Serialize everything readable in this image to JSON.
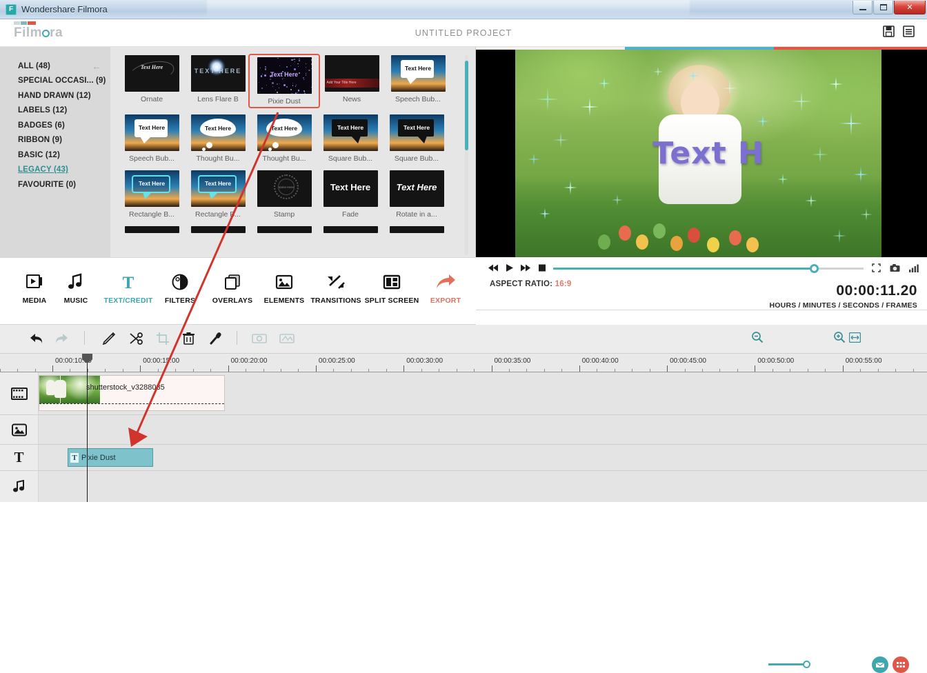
{
  "window": {
    "title": "Wondershare Filmora",
    "app_icon": "F",
    "minimize": "minimize-icon",
    "maximize": "maximize-icon",
    "close": "✕"
  },
  "header": {
    "brand": "Film",
    "brand_suffix": "ra",
    "project_title": "UNTITLED PROJECT",
    "save_icon": "save-icon",
    "menu_icon": "menu-icon"
  },
  "library": {
    "categories": [
      {
        "label": "ALL (48)",
        "active": false
      },
      {
        "label": "SPECIAL OCCASI...  (9)",
        "active": false
      },
      {
        "label": "HAND DRAWN (12)",
        "active": false
      },
      {
        "label": "LABELS (12)",
        "active": false
      },
      {
        "label": "BADGES (6)",
        "active": false
      },
      {
        "label": "RIBBON (9)",
        "active": false
      },
      {
        "label": "BASIC (12)",
        "active": false
      },
      {
        "label": "LEGACY (43)",
        "active": true
      },
      {
        "label": "FAVOURITE (0)",
        "active": false
      }
    ],
    "collapse_icon": "←",
    "items": [
      {
        "caption": "Ornate",
        "art": "ornate",
        "text": "Text Here",
        "selected": false
      },
      {
        "caption": "Lens Flare B",
        "art": "flare",
        "text": "TEXT HERE",
        "selected": false
      },
      {
        "caption": "Pixie Dust",
        "art": "pixie",
        "text": "Text Here",
        "selected": true
      },
      {
        "caption": "News",
        "art": "news",
        "text": "Add Your Title Here",
        "selected": false
      },
      {
        "caption": "Speech Bub...",
        "art": "speech-w",
        "text": "Text Here",
        "selected": false
      },
      {
        "caption": "Speech Bub...",
        "art": "speech-w",
        "text": "Text Here",
        "selected": false
      },
      {
        "caption": "Thought Bu...",
        "art": "cloud",
        "text": "Text Here",
        "selected": false
      },
      {
        "caption": "Thought Bu...",
        "art": "cloud",
        "text": "Text Here",
        "selected": false
      },
      {
        "caption": "Square Bub...",
        "art": "speech-b",
        "text": "Text Here",
        "selected": false
      },
      {
        "caption": "Square Bub...",
        "art": "speech-b",
        "text": "Text Here",
        "selected": false
      },
      {
        "caption": "Rectangle B...",
        "art": "rect",
        "text": "Text Here",
        "selected": false
      },
      {
        "caption": "Rectangle B...",
        "art": "rect",
        "text": "Text Here",
        "selected": false
      },
      {
        "caption": "Stamp",
        "art": "stamp",
        "text": "Name Here",
        "selected": false
      },
      {
        "caption": "Fade",
        "art": "plain",
        "text": "Text Here",
        "selected": false
      },
      {
        "caption": "Rotate in a...",
        "art": "italic",
        "text": "Text Here",
        "selected": false
      }
    ]
  },
  "preview": {
    "overlay_text": "Text H",
    "player": {
      "prev_icon": "rewind-icon",
      "play_icon": "play-icon",
      "next_icon": "fast-forward-icon",
      "stop_icon": "stop-icon",
      "fullscreen_icon": "fullscreen-icon",
      "snapshot_icon": "camera-icon",
      "quality_icon": "signal-icon",
      "progress_percent": 84
    },
    "aspect_label": "ASPECT RATIO:",
    "aspect_value": "16:9",
    "timecode": "00:00:11.20",
    "timecode_units": "HOURS / MINUTES / SECONDS / FRAMES"
  },
  "toolbar": {
    "items": [
      {
        "label": "MEDIA",
        "icon": "media-icon",
        "state": "normal"
      },
      {
        "label": "MUSIC",
        "icon": "music-icon",
        "state": "normal"
      },
      {
        "label": "TEXT/CREDIT",
        "icon": "text-credit-icon",
        "state": "active"
      },
      {
        "label": "FILTERS",
        "icon": "filters-icon",
        "state": "normal"
      },
      {
        "label": "OVERLAYS",
        "icon": "overlays-icon",
        "state": "normal"
      },
      {
        "label": "ELEMENTS",
        "icon": "elements-icon",
        "state": "normal"
      },
      {
        "label": "TRANSITIONS",
        "icon": "transitions-icon",
        "state": "normal"
      },
      {
        "label": "SPLIT SCREEN",
        "icon": "split-screen-icon",
        "state": "normal"
      },
      {
        "label": "EXPORT",
        "icon": "export-icon",
        "state": "export"
      }
    ]
  },
  "timeline": {
    "tools": [
      {
        "name": "undo-icon",
        "enabled": true
      },
      {
        "name": "redo-icon",
        "enabled": false
      },
      {
        "name": "edit-icon",
        "enabled": true
      },
      {
        "name": "cut-icon",
        "enabled": true
      },
      {
        "name": "crop-icon",
        "enabled": false
      },
      {
        "name": "delete-icon",
        "enabled": true
      },
      {
        "name": "voiceover-icon",
        "enabled": true
      },
      {
        "name": "pan-zoom-icon",
        "enabled": false
      },
      {
        "name": "green-screen-icon",
        "enabled": false
      }
    ],
    "zoom_out_icon": "zoom-out-icon",
    "zoom_in_icon": "zoom-in-icon",
    "fit_icon": "fit-to-timeline-icon",
    "zoom_percent": 62,
    "snapshot_icon": "snapshot-button",
    "record_icon": "record-button",
    "ruler_labels": [
      "00:00:10:00",
      "00:00:15:00",
      "00:00:20:00",
      "00:00:25:00",
      "00:00:30:00",
      "00:00:35:00",
      "00:00:40:00",
      "00:00:45:00",
      "00:00:50:00",
      "00:00:55:00"
    ],
    "tracks": [
      {
        "icon": "video-track-icon",
        "name": "video-track"
      },
      {
        "icon": "image-track-icon",
        "name": "image-track"
      },
      {
        "icon": "text-track-icon",
        "name": "text-track"
      },
      {
        "icon": "audio-track-icon",
        "name": "audio-track"
      }
    ],
    "video_clip_name": "shutterstock_v3288035",
    "text_clip_name": "Pixie Dust",
    "text_clip_badge": "T"
  },
  "annotation": {
    "arrow": "red-arrow-from-pixie-dust-to-text-track"
  },
  "colors": {
    "accent_teal": "#49b0b8",
    "accent_red": "#e0574a",
    "selection_red": "#e0574a",
    "clip_teal": "#7ec3cc",
    "arrow_red": "#d1342c"
  }
}
